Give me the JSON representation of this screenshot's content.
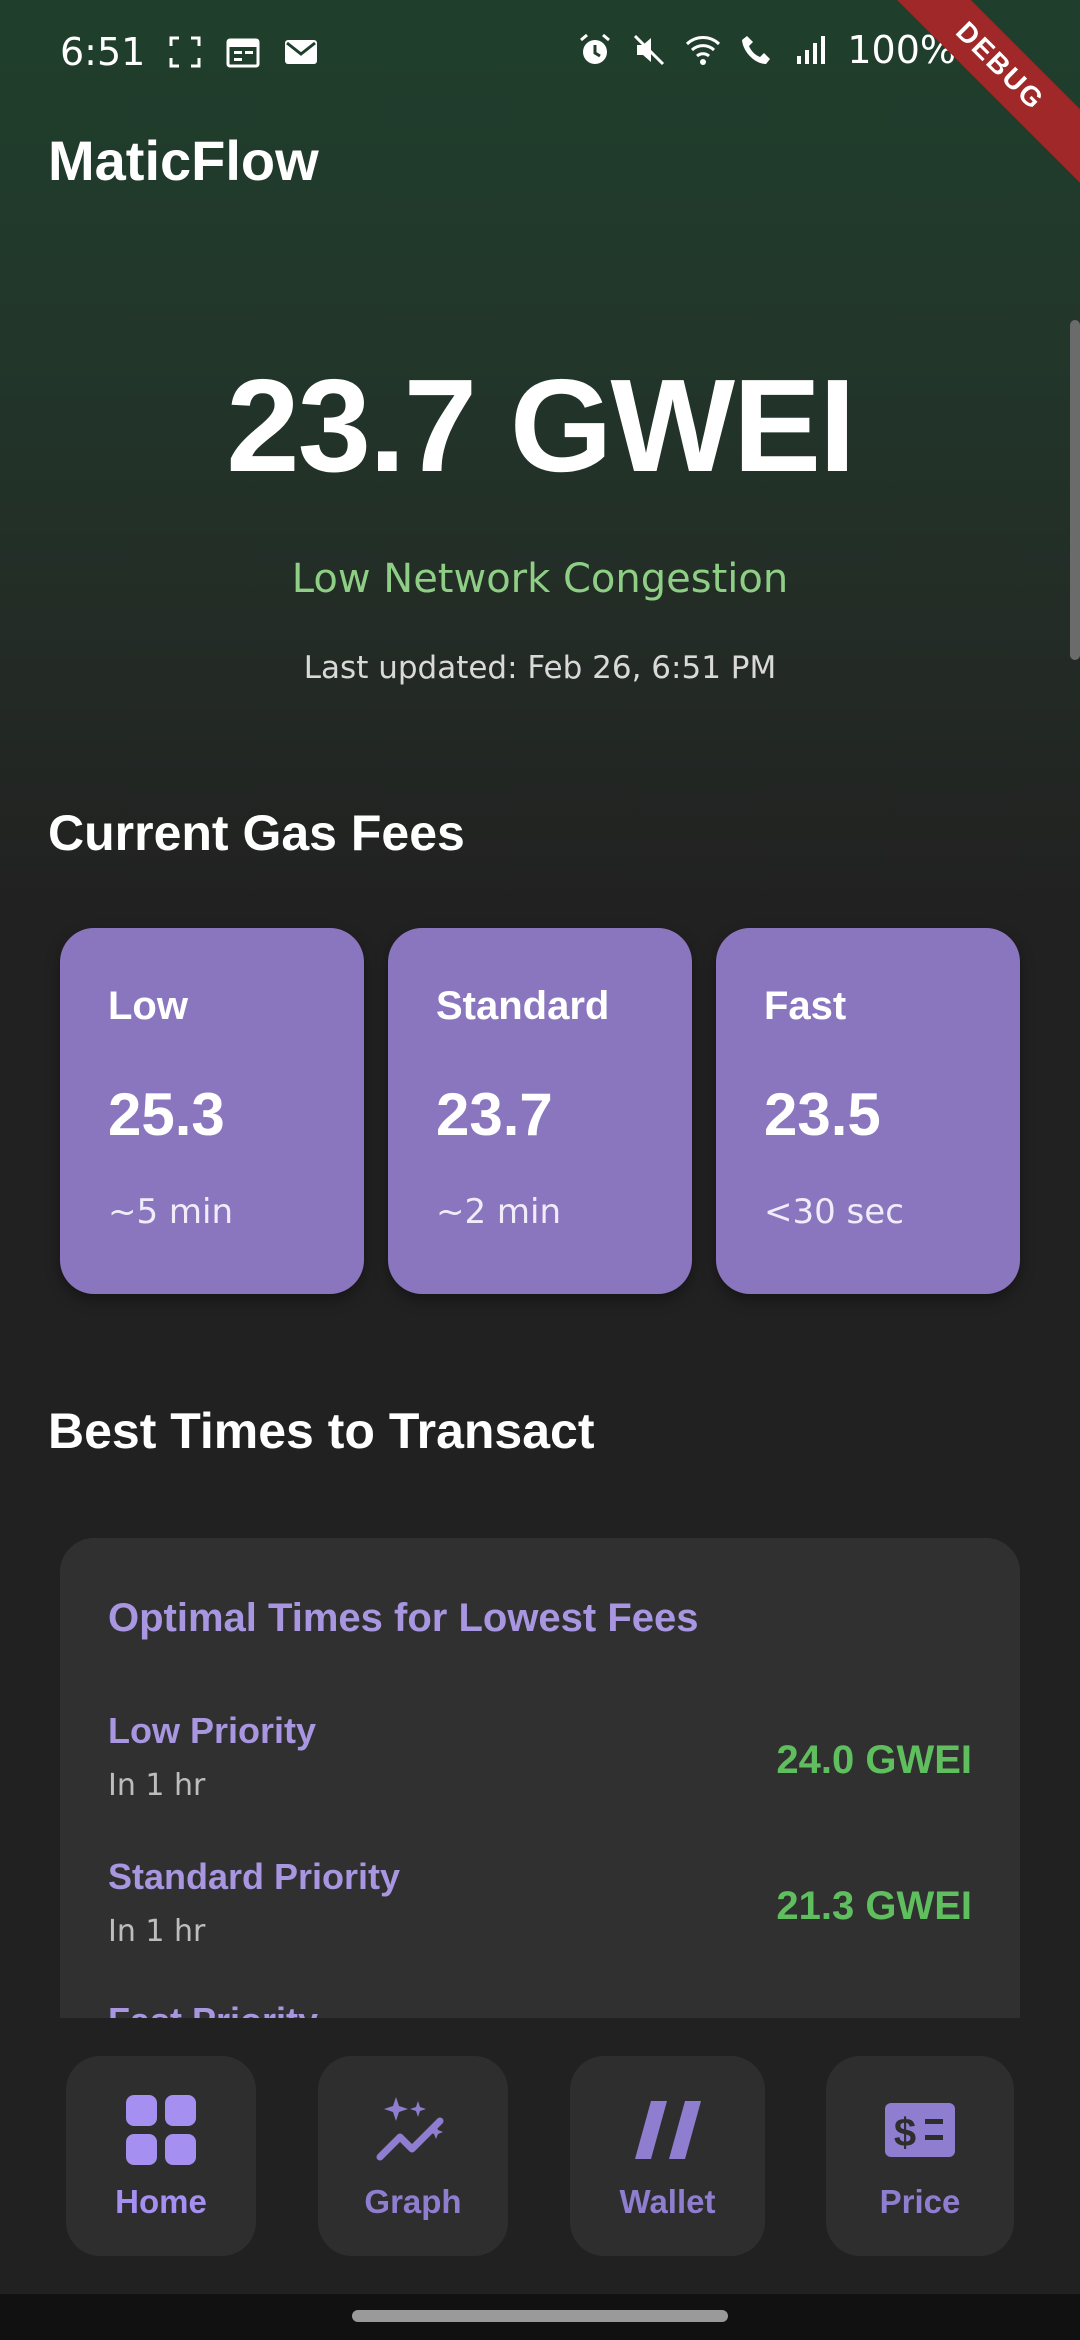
{
  "status_bar": {
    "time": "6:51",
    "battery": "100%"
  },
  "debug_banner": "DEBUG",
  "app": {
    "title": "MaticFlow"
  },
  "hero": {
    "price": "23.7 GWEI",
    "congestion": "Low Network Congestion",
    "last_updated": "Last updated: Feb 26, 6:51 PM"
  },
  "current_fees": {
    "title": "Current Gas Fees",
    "cards": [
      {
        "name": "Low",
        "value": "25.3",
        "eta": "~5 min"
      },
      {
        "name": "Standard",
        "value": "23.7",
        "eta": "~2 min"
      },
      {
        "name": "Fast",
        "value": "23.5",
        "eta": "<30 sec"
      }
    ]
  },
  "best_times": {
    "title": "Best Times to Transact",
    "card_title": "Optimal Times for Lowest Fees",
    "rows": [
      {
        "name": "Low Priority",
        "when": "In 1 hr",
        "value": "24.0 GWEI"
      },
      {
        "name": "Standard Priority",
        "when": "In 1 hr",
        "value": "21.3 GWEI"
      },
      {
        "name": "Fast Priority",
        "when": "",
        "value": ""
      }
    ]
  },
  "bottom_nav": [
    {
      "label": "Home",
      "icon": "grid-icon",
      "active": true
    },
    {
      "label": "Graph",
      "icon": "trend-sparkle-icon",
      "active": false
    },
    {
      "label": "Wallet",
      "icon": "polygon-icon",
      "active": false
    },
    {
      "label": "Price",
      "icon": "dollar-ticket-icon",
      "active": false
    }
  ],
  "colors": {
    "accent_purple": "#8a76bf",
    "label_purple": "#a896e0",
    "positive_green": "#5fbf5e",
    "congestion_green": "#8fce85",
    "background": "#212121"
  }
}
